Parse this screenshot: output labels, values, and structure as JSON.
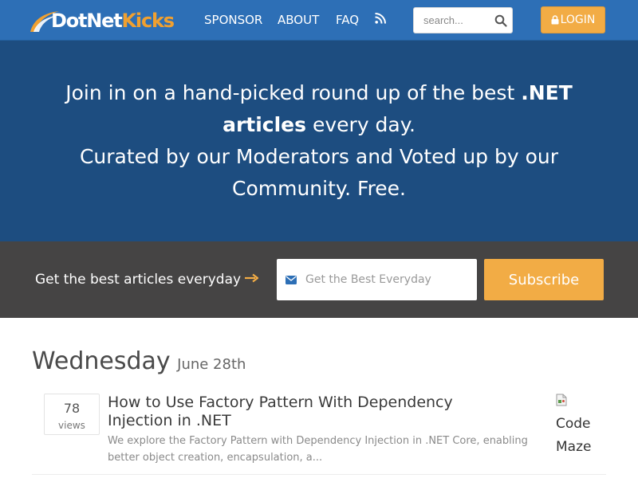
{
  "navbar": {
    "logo": {
      "part1": "DotNet",
      "part2": "Kicks"
    },
    "links": {
      "sponsor": "SPONSOR",
      "about": "ABOUT",
      "faq": "FAQ"
    },
    "rss_icon": "rss-icon",
    "search": {
      "placeholder": "search...",
      "value": "",
      "icon": "search-icon"
    },
    "login": {
      "label": "LOGIN",
      "icon": "lock-icon"
    },
    "colors": {
      "background": "#2d6fb6",
      "accent": "#f2ac45"
    }
  },
  "hero": {
    "line1_pre": "Join in on a hand-picked round up of the best ",
    "line1_bold": ".NET articles",
    "line1_post": " every day.",
    "line2": "Curated by our Moderators and Voted up by our Community. Free.",
    "background": "#1d4d80"
  },
  "subscribe": {
    "label": "Get the best articles everyday",
    "arrow_icon": "arrow-right-icon",
    "email_icon": "envelope-icon",
    "email_placeholder": "Get the Best Everyday",
    "email_value": "",
    "button": "Subscribe",
    "background": "#454444"
  },
  "day": {
    "name": "Wednesday",
    "date": "June 28th"
  },
  "articles": [
    {
      "views": "78",
      "views_label": "views",
      "title": "How to Use Factory Pattern With Dependency Injection in .NET",
      "description": "We explore the Factory Pattern with Dependency Injection in .NET Core, enabling better object creation, encapsulation, a...",
      "source_alt": "Code Maze"
    }
  ]
}
